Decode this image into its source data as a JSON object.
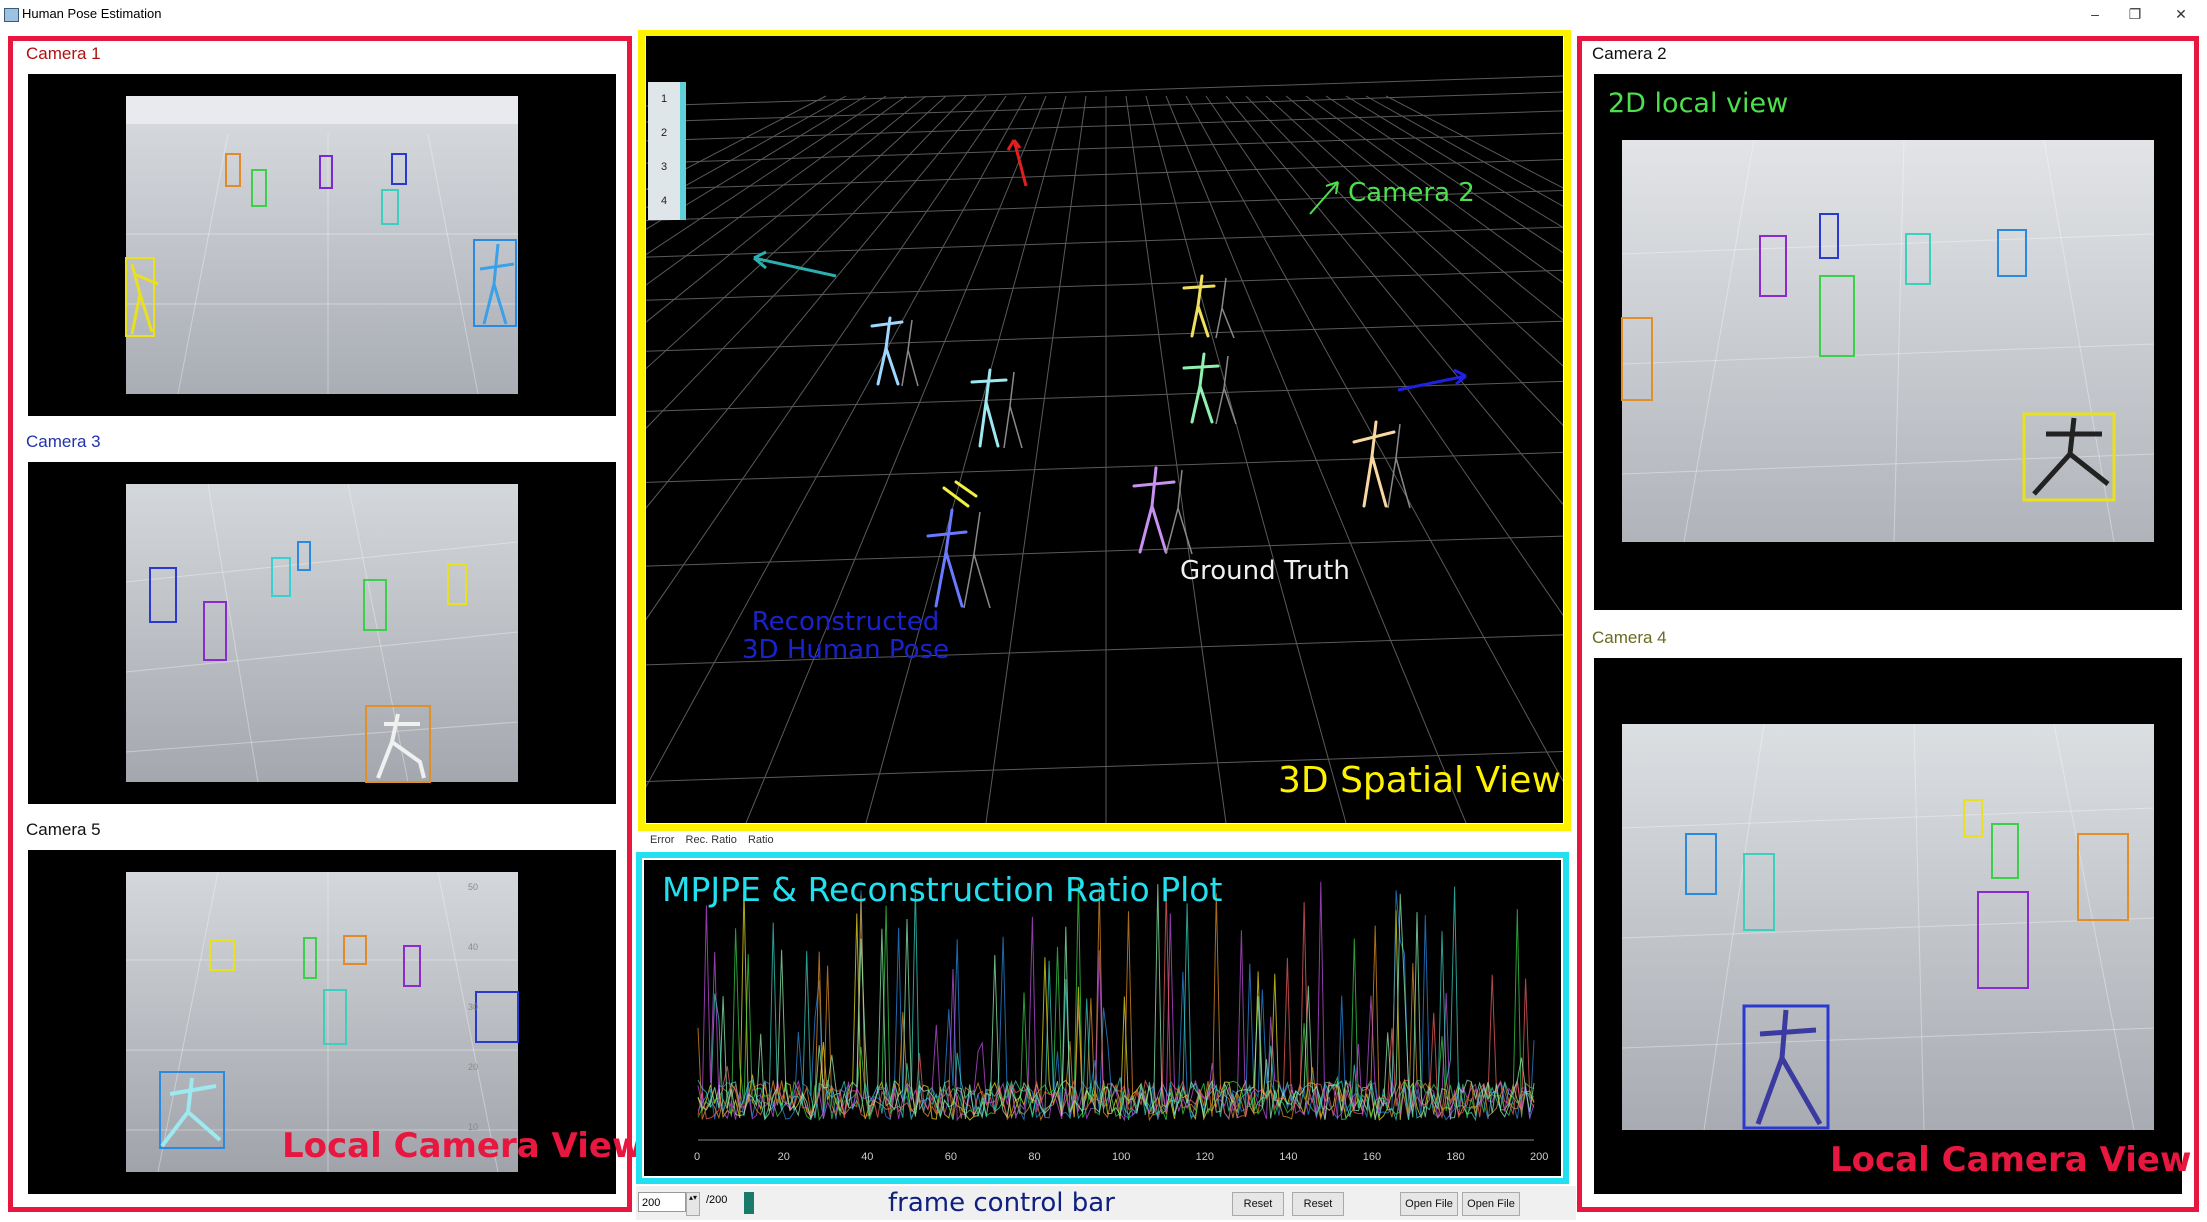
{
  "window": {
    "title": "Human Pose Estimation",
    "minimize": "–",
    "restore": "❐",
    "close": "✕"
  },
  "left_panel": {
    "cameras": [
      {
        "label": "Camera 1"
      },
      {
        "label": "Camera 3"
      },
      {
        "label": "Camera 5"
      }
    ],
    "overlay": "Local Camera View"
  },
  "right_panel": {
    "cameras": [
      {
        "label": "Camera 2"
      },
      {
        "label": "Camera 4"
      }
    ],
    "local_view_label": "2D local view",
    "overlay": "Local Camera View"
  },
  "spatial_view": {
    "side_tabs": [
      "1",
      "2",
      "3",
      "4"
    ],
    "camera_label": "Camera 2",
    "ground_truth_label": "Ground Truth",
    "reconstructed_label_line1": "Reconstructed",
    "reconstructed_label_line2": "3D Human Pose",
    "overlay": "3D Spatial View"
  },
  "plot": {
    "tabs": [
      "Error",
      "Rec. Ratio",
      "Ratio"
    ],
    "overlay": "MPJPE & Reconstruction Ratio Plot",
    "x_ticks": [
      "0",
      "20",
      "40",
      "60",
      "80",
      "100",
      "120",
      "140",
      "160",
      "180",
      "200"
    ]
  },
  "control_bar": {
    "label": "frame control bar",
    "frame_value": "200",
    "frame_total": "/200",
    "reset_btn_1": "Reset",
    "reset_btn_2": "Reset",
    "open_file_1": "Open File",
    "open_file_2": "Open File"
  },
  "colors": {
    "red_outline": "#e8173f",
    "yellow_outline": "#fff200",
    "cyan_outline": "#22e0f0",
    "green_text": "#4de04d",
    "blue_text": "#1a22cc"
  }
}
